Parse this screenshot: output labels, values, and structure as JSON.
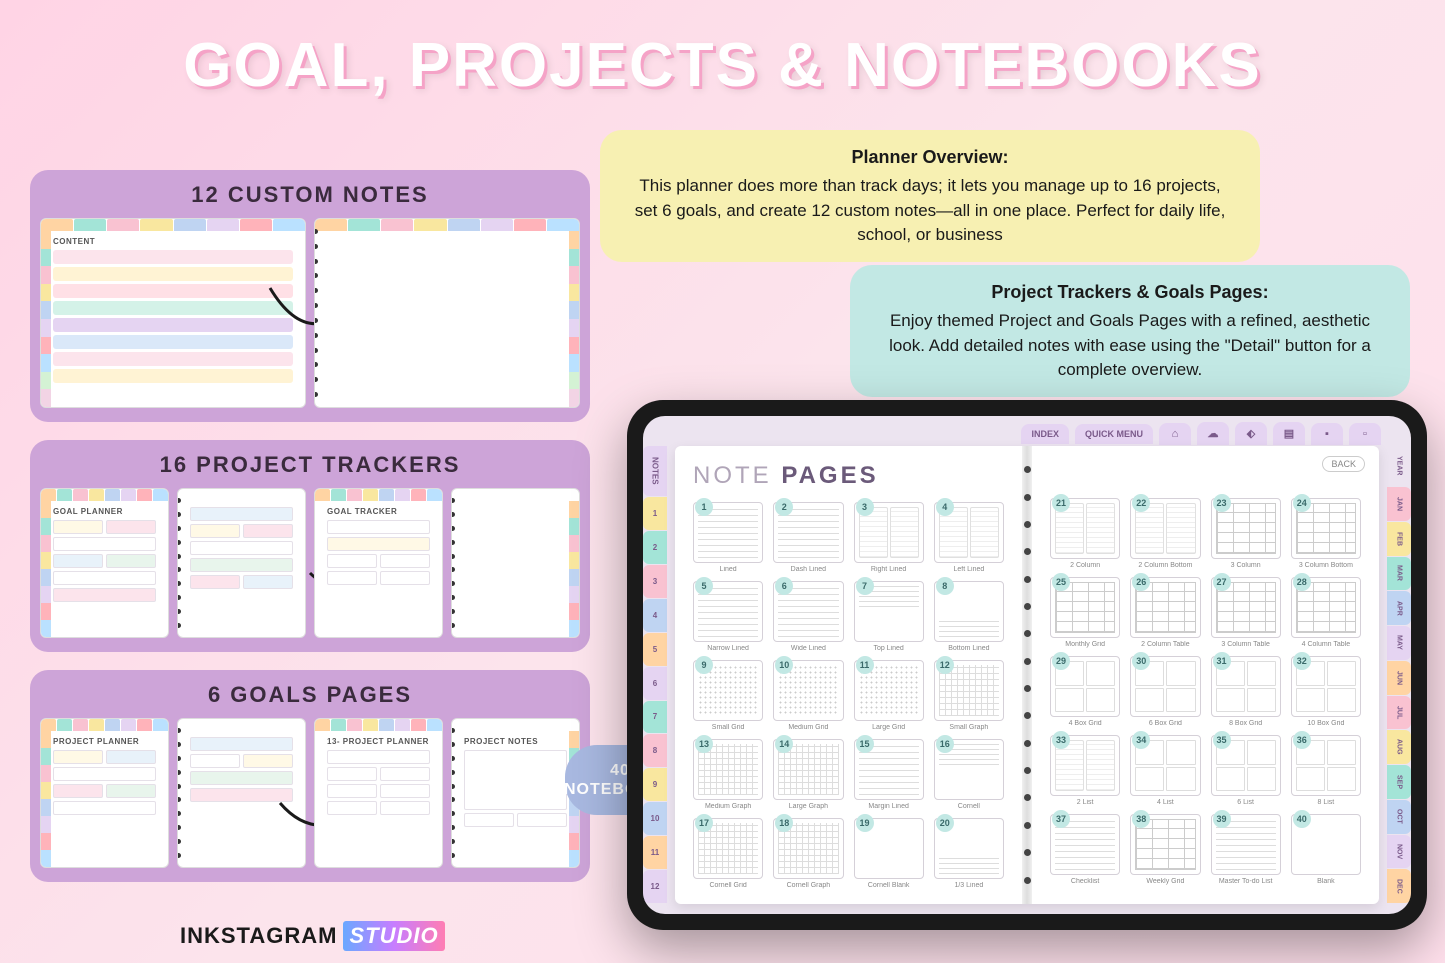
{
  "title": "GOAL, PROJECTS & NOTEBOOKS",
  "sections": {
    "custom_notes": {
      "title": "12 CUSTOM NOTES",
      "page1_heading": "CONTENT"
    },
    "project_trackers": {
      "title": "16 PROJECT TRACKERS",
      "page1_heading": "GOAL PLANNER",
      "page3_heading": "GOAL TRACKER"
    },
    "goals_pages": {
      "title": "6 GOALS PAGES",
      "page1_heading": "PROJECT PLANNER",
      "page3_heading": "13- PROJECT PLANNER",
      "page4_heading": "PROJECT NOTES"
    }
  },
  "blobs": {
    "overview": {
      "title": "Planner Overview:",
      "text": "This planner does more than track days; it lets you manage up to 16 projects, set 6 goals, and create 12 custom notes—all in one place. Perfect for daily life, school, or business"
    },
    "trackers": {
      "title": "Project Trackers & Goals Pages:",
      "text": "Enjoy themed Project and Goals Pages with a refined, aesthetic look. Add detailed notes with ease using the \"Detail\" button for a complete overview."
    }
  },
  "badge": {
    "line1": "40",
    "line2": "NOTEBOOKS"
  },
  "ipad": {
    "nav": {
      "index": "INDEX",
      "quick_menu": "QUICK MENU",
      "back": "BACK"
    },
    "book_title_light": "NOTE",
    "book_title_bold": "PAGES",
    "left_tabs": {
      "notes": "NOTES",
      "nums": [
        "1",
        "2",
        "3",
        "4",
        "5",
        "6",
        "7",
        "8",
        "9",
        "10",
        "11",
        "12"
      ]
    },
    "right_tabs": [
      "YEAR",
      "JAN",
      "FEB",
      "MAR",
      "APR",
      "MAY",
      "JUN",
      "JUL",
      "AUG",
      "SEP",
      "OCT",
      "NOV",
      "DEC"
    ],
    "pages": [
      {
        "n": "1",
        "label": "Lined",
        "t": "lines"
      },
      {
        "n": "2",
        "label": "Dash Lined",
        "t": "lines"
      },
      {
        "n": "3",
        "label": "Right Lined",
        "t": "col2"
      },
      {
        "n": "4",
        "label": "Left Lined",
        "t": "col2"
      },
      {
        "n": "5",
        "label": "Narrow Lined",
        "t": "lines"
      },
      {
        "n": "6",
        "label": "Wide Lined",
        "t": "lines"
      },
      {
        "n": "7",
        "label": "Top Lined",
        "t": "toplines"
      },
      {
        "n": "8",
        "label": "Bottom Lined",
        "t": "botlines"
      },
      {
        "n": "9",
        "label": "Small Grid",
        "t": "dots"
      },
      {
        "n": "10",
        "label": "Medium Grid",
        "t": "dots"
      },
      {
        "n": "11",
        "label": "Large Grid",
        "t": "dots"
      },
      {
        "n": "12",
        "label": "Small Graph",
        "t": "grid"
      },
      {
        "n": "13",
        "label": "Medium Graph",
        "t": "grid"
      },
      {
        "n": "14",
        "label": "Large Graph",
        "t": "grid"
      },
      {
        "n": "15",
        "label": "Margin Lined",
        "t": "lines"
      },
      {
        "n": "16",
        "label": "Cornell",
        "t": "toplines"
      },
      {
        "n": "17",
        "label": "Cornell Grid",
        "t": "grid"
      },
      {
        "n": "18",
        "label": "Cornell Graph",
        "t": "grid"
      },
      {
        "n": "19",
        "label": "Cornell Blank",
        "t": "blank"
      },
      {
        "n": "20",
        "label": "1/3 Lined",
        "t": "botlines"
      },
      {
        "n": "21",
        "label": "2 Column",
        "t": "col2"
      },
      {
        "n": "22",
        "label": "2 Column Bottom",
        "t": "col2"
      },
      {
        "n": "23",
        "label": "3 Column",
        "t": "table"
      },
      {
        "n": "24",
        "label": "3 Column Bottom",
        "t": "table"
      },
      {
        "n": "25",
        "label": "Monthly Grid",
        "t": "table"
      },
      {
        "n": "26",
        "label": "2 Column Table",
        "t": "table"
      },
      {
        "n": "27",
        "label": "3 Column Table",
        "t": "table"
      },
      {
        "n": "28",
        "label": "4 Column Table",
        "t": "table"
      },
      {
        "n": "29",
        "label": "4 Box Grid",
        "t": "boxes"
      },
      {
        "n": "30",
        "label": "6 Box Grid",
        "t": "boxes"
      },
      {
        "n": "31",
        "label": "8 Box Grid",
        "t": "boxes"
      },
      {
        "n": "32",
        "label": "10 Box Grid",
        "t": "boxes"
      },
      {
        "n": "33",
        "label": "2 List",
        "t": "col2"
      },
      {
        "n": "34",
        "label": "4 List",
        "t": "boxes"
      },
      {
        "n": "35",
        "label": "6 List",
        "t": "boxes"
      },
      {
        "n": "36",
        "label": "8 List",
        "t": "boxes"
      },
      {
        "n": "37",
        "label": "Checklist",
        "t": "lines"
      },
      {
        "n": "38",
        "label": "Weekly Grid",
        "t": "table"
      },
      {
        "n": "39",
        "label": "Master To-do List",
        "t": "lines"
      },
      {
        "n": "40",
        "label": "Blank",
        "t": "blank"
      }
    ]
  },
  "brand": {
    "name": "INKSTAGRAM",
    "studio": "STUDIO"
  }
}
